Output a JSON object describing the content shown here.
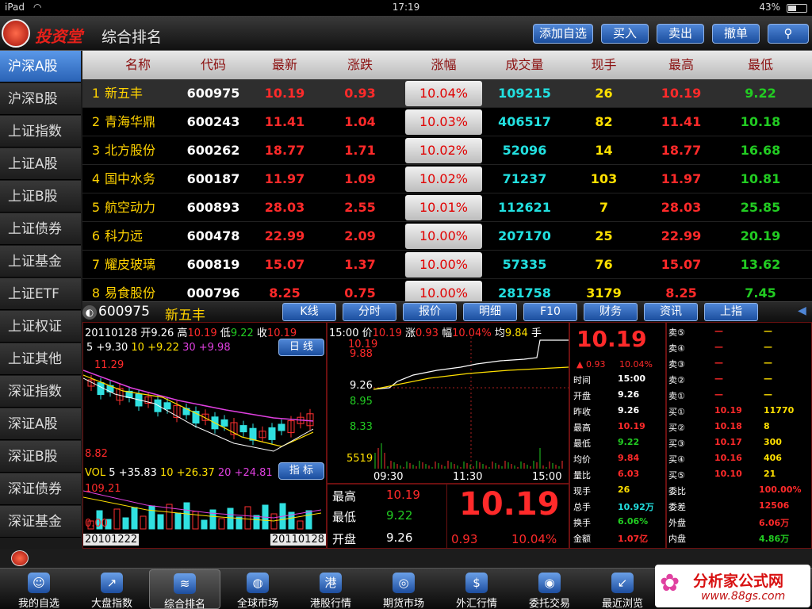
{
  "status": {
    "device": "iPad",
    "time": "17:19",
    "battery": "43%"
  },
  "header": {
    "brand": "投资堂",
    "title": "综合排名"
  },
  "toolbar": {
    "add_watch": "添加自选",
    "buy": "买入",
    "sell": "卖出",
    "cancel": "撤单",
    "search_icon": "search-icon"
  },
  "sidebar": {
    "items": [
      "沪深A股",
      "沪深B股",
      "上证指数",
      "上证A股",
      "上证B股",
      "上证债券",
      "上证基金",
      "上证ETF",
      "上证权证",
      "上证其他",
      "深证指数",
      "深证A股",
      "深证B股",
      "深证债券",
      "深证基金"
    ]
  },
  "table": {
    "headers": [
      "名称",
      "代码",
      "最新",
      "涨跌",
      "涨幅",
      "成交量",
      "现手",
      "最高",
      "最低"
    ],
    "rows": [
      {
        "idx": "1",
        "name": "新五丰",
        "code": "600975",
        "last": "10.19",
        "chg": "0.93",
        "pct": "10.04%",
        "vol": "109215",
        "hand": "26",
        "high": "10.19",
        "low": "9.22"
      },
      {
        "idx": "2",
        "name": "青海华鼎",
        "code": "600243",
        "last": "11.41",
        "chg": "1.04",
        "pct": "10.03%",
        "vol": "406517",
        "hand": "82",
        "high": "11.41",
        "low": "10.18"
      },
      {
        "idx": "3",
        "name": "北方股份",
        "code": "600262",
        "last": "18.77",
        "chg": "1.71",
        "pct": "10.02%",
        "vol": "52096",
        "hand": "14",
        "high": "18.77",
        "low": "16.68"
      },
      {
        "idx": "4",
        "name": "国中水务",
        "code": "600187",
        "last": "11.97",
        "chg": "1.09",
        "pct": "10.02%",
        "vol": "71237",
        "hand": "103",
        "high": "11.97",
        "low": "10.81"
      },
      {
        "idx": "5",
        "name": "航空动力",
        "code": "600893",
        "last": "28.03",
        "chg": "2.55",
        "pct": "10.01%",
        "vol": "112621",
        "hand": "7",
        "high": "28.03",
        "low": "25.85"
      },
      {
        "idx": "6",
        "name": "科力远",
        "code": "600478",
        "last": "22.99",
        "chg": "2.09",
        "pct": "10.00%",
        "vol": "207170",
        "hand": "25",
        "high": "22.99",
        "low": "20.19"
      },
      {
        "idx": "7",
        "name": "耀皮玻璃",
        "code": "600819",
        "last": "15.07",
        "chg": "1.37",
        "pct": "10.00%",
        "vol": "57335",
        "hand": "76",
        "high": "15.07",
        "low": "13.62"
      },
      {
        "idx": "8",
        "name": "易食股份",
        "code": "000796",
        "last": "8.25",
        "chg": "0.75",
        "pct": "10.00%",
        "vol": "281758",
        "hand": "3179",
        "high": "8.25",
        "low": "7.45"
      }
    ]
  },
  "stock": {
    "code": "600975",
    "name": "新五丰"
  },
  "detail_tabs": [
    "K线",
    "分时",
    "报价",
    "明细",
    "F10",
    "财务",
    "资讯",
    "上指"
  ],
  "kline": {
    "date": "20110128",
    "open_lbl": "开",
    "open": "9.26",
    "high_lbl": "高",
    "high": "10.19",
    "low_lbl": "低",
    "low": "9.22",
    "close_lbl": "收",
    "close": "10.19",
    "ma_line": {
      "p1": "5",
      "v1": "+9.30",
      "p2": "10",
      "v2": "+9.22",
      "p3": "30",
      "v3": "+9.98"
    },
    "daily_btn": "日 线",
    "top_val": "11.29",
    "bottom_val": "8.82",
    "vol_line": {
      "lbl": "VOL",
      "p1": "5",
      "v1": "+35.83",
      "p2": "10",
      "v2": "+26.37",
      "p3": "20",
      "v3": "+24.81"
    },
    "indicator_btn": "指 标",
    "vol_top": "109.21",
    "vol_bottom": "0.00",
    "start_date": "20101222",
    "end_date": "20110128"
  },
  "intraday": {
    "time": "15:00",
    "price_lbl": "价",
    "price": "10.19",
    "chg_lbl": "涨",
    "chg": "0.93",
    "pct_lbl": "幅",
    "pct": "10.04%",
    "avg_lbl": "均",
    "avg": "9.84",
    "hand_lbl": "手",
    "y_top": "10.19",
    "y2": "9.88",
    "y_mid": "9.26",
    "y4": "8.95",
    "y5": "8.33",
    "vol_max": "5519",
    "t1": "09:30",
    "t2": "11:30",
    "t3": "15:00"
  },
  "summary": {
    "high_lbl": "最高",
    "high": "10.19",
    "low_lbl": "最低",
    "low": "9.22",
    "open_lbl": "开盘",
    "open": "9.26",
    "big_price": "10.19",
    "chg": "0.93",
    "pct": "10.04%"
  },
  "quote": {
    "price": "10.19",
    "chg": "▲ 0.93",
    "pct": "10.04%",
    "fields": [
      {
        "k": "时间",
        "v": "15:00"
      },
      {
        "k": "开盘",
        "v": "9.26"
      },
      {
        "k": "昨收",
        "v": "9.26"
      },
      {
        "k": "最高",
        "v": "10.19"
      },
      {
        "k": "最低",
        "v": "9.22"
      },
      {
        "k": "均价",
        "v": "9.84"
      },
      {
        "k": "量比",
        "v": "6.03"
      },
      {
        "k": "现手",
        "v": "26"
      },
      {
        "k": "总手",
        "v": "10.92万"
      },
      {
        "k": "换手",
        "v": "6.06%"
      },
      {
        "k": "金额",
        "v": "1.07亿"
      }
    ],
    "book": [
      {
        "k": "卖⑤",
        "p": "—",
        "q": "—"
      },
      {
        "k": "卖④",
        "p": "—",
        "q": "—"
      },
      {
        "k": "卖③",
        "p": "—",
        "q": "—"
      },
      {
        "k": "卖②",
        "p": "—",
        "q": "—"
      },
      {
        "k": "卖①",
        "p": "—",
        "q": "—"
      },
      {
        "k": "买①",
        "p": "10.19",
        "q": "11770"
      },
      {
        "k": "买②",
        "p": "10.18",
        "q": "8"
      },
      {
        "k": "买③",
        "p": "10.17",
        "q": "300"
      },
      {
        "k": "买④",
        "p": "10.16",
        "q": "406"
      },
      {
        "k": "买⑤",
        "p": "10.10",
        "q": "21"
      }
    ],
    "stats": [
      {
        "k": "委比",
        "v": "100.00%"
      },
      {
        "k": "委差",
        "v": "12506"
      },
      {
        "k": "外盘",
        "v": "6.06万"
      },
      {
        "k": "内盘",
        "v": "4.86万"
      }
    ]
  },
  "nav": [
    {
      "label": "我的自选",
      "icon": "user-icon",
      "glyph": "☺"
    },
    {
      "label": "大盘指数",
      "icon": "index-chart-icon",
      "glyph": "↗"
    },
    {
      "label": "综合排名",
      "icon": "ranking-icon",
      "glyph": "≋"
    },
    {
      "label": "全球市场",
      "icon": "globe-icon",
      "glyph": "◍"
    },
    {
      "label": "港股行情",
      "icon": "hk-icon",
      "glyph": "港"
    },
    {
      "label": "期货市场",
      "icon": "futures-icon",
      "glyph": "◎"
    },
    {
      "label": "外汇行情",
      "icon": "dollar-icon",
      "glyph": "$"
    },
    {
      "label": "委托交易",
      "icon": "trade-icon",
      "glyph": "◉"
    },
    {
      "label": "最近浏览",
      "icon": "recent-icon",
      "glyph": "↙"
    }
  ],
  "watermark": {
    "text": "分析家公式网",
    "url": "www.88gs.com"
  }
}
